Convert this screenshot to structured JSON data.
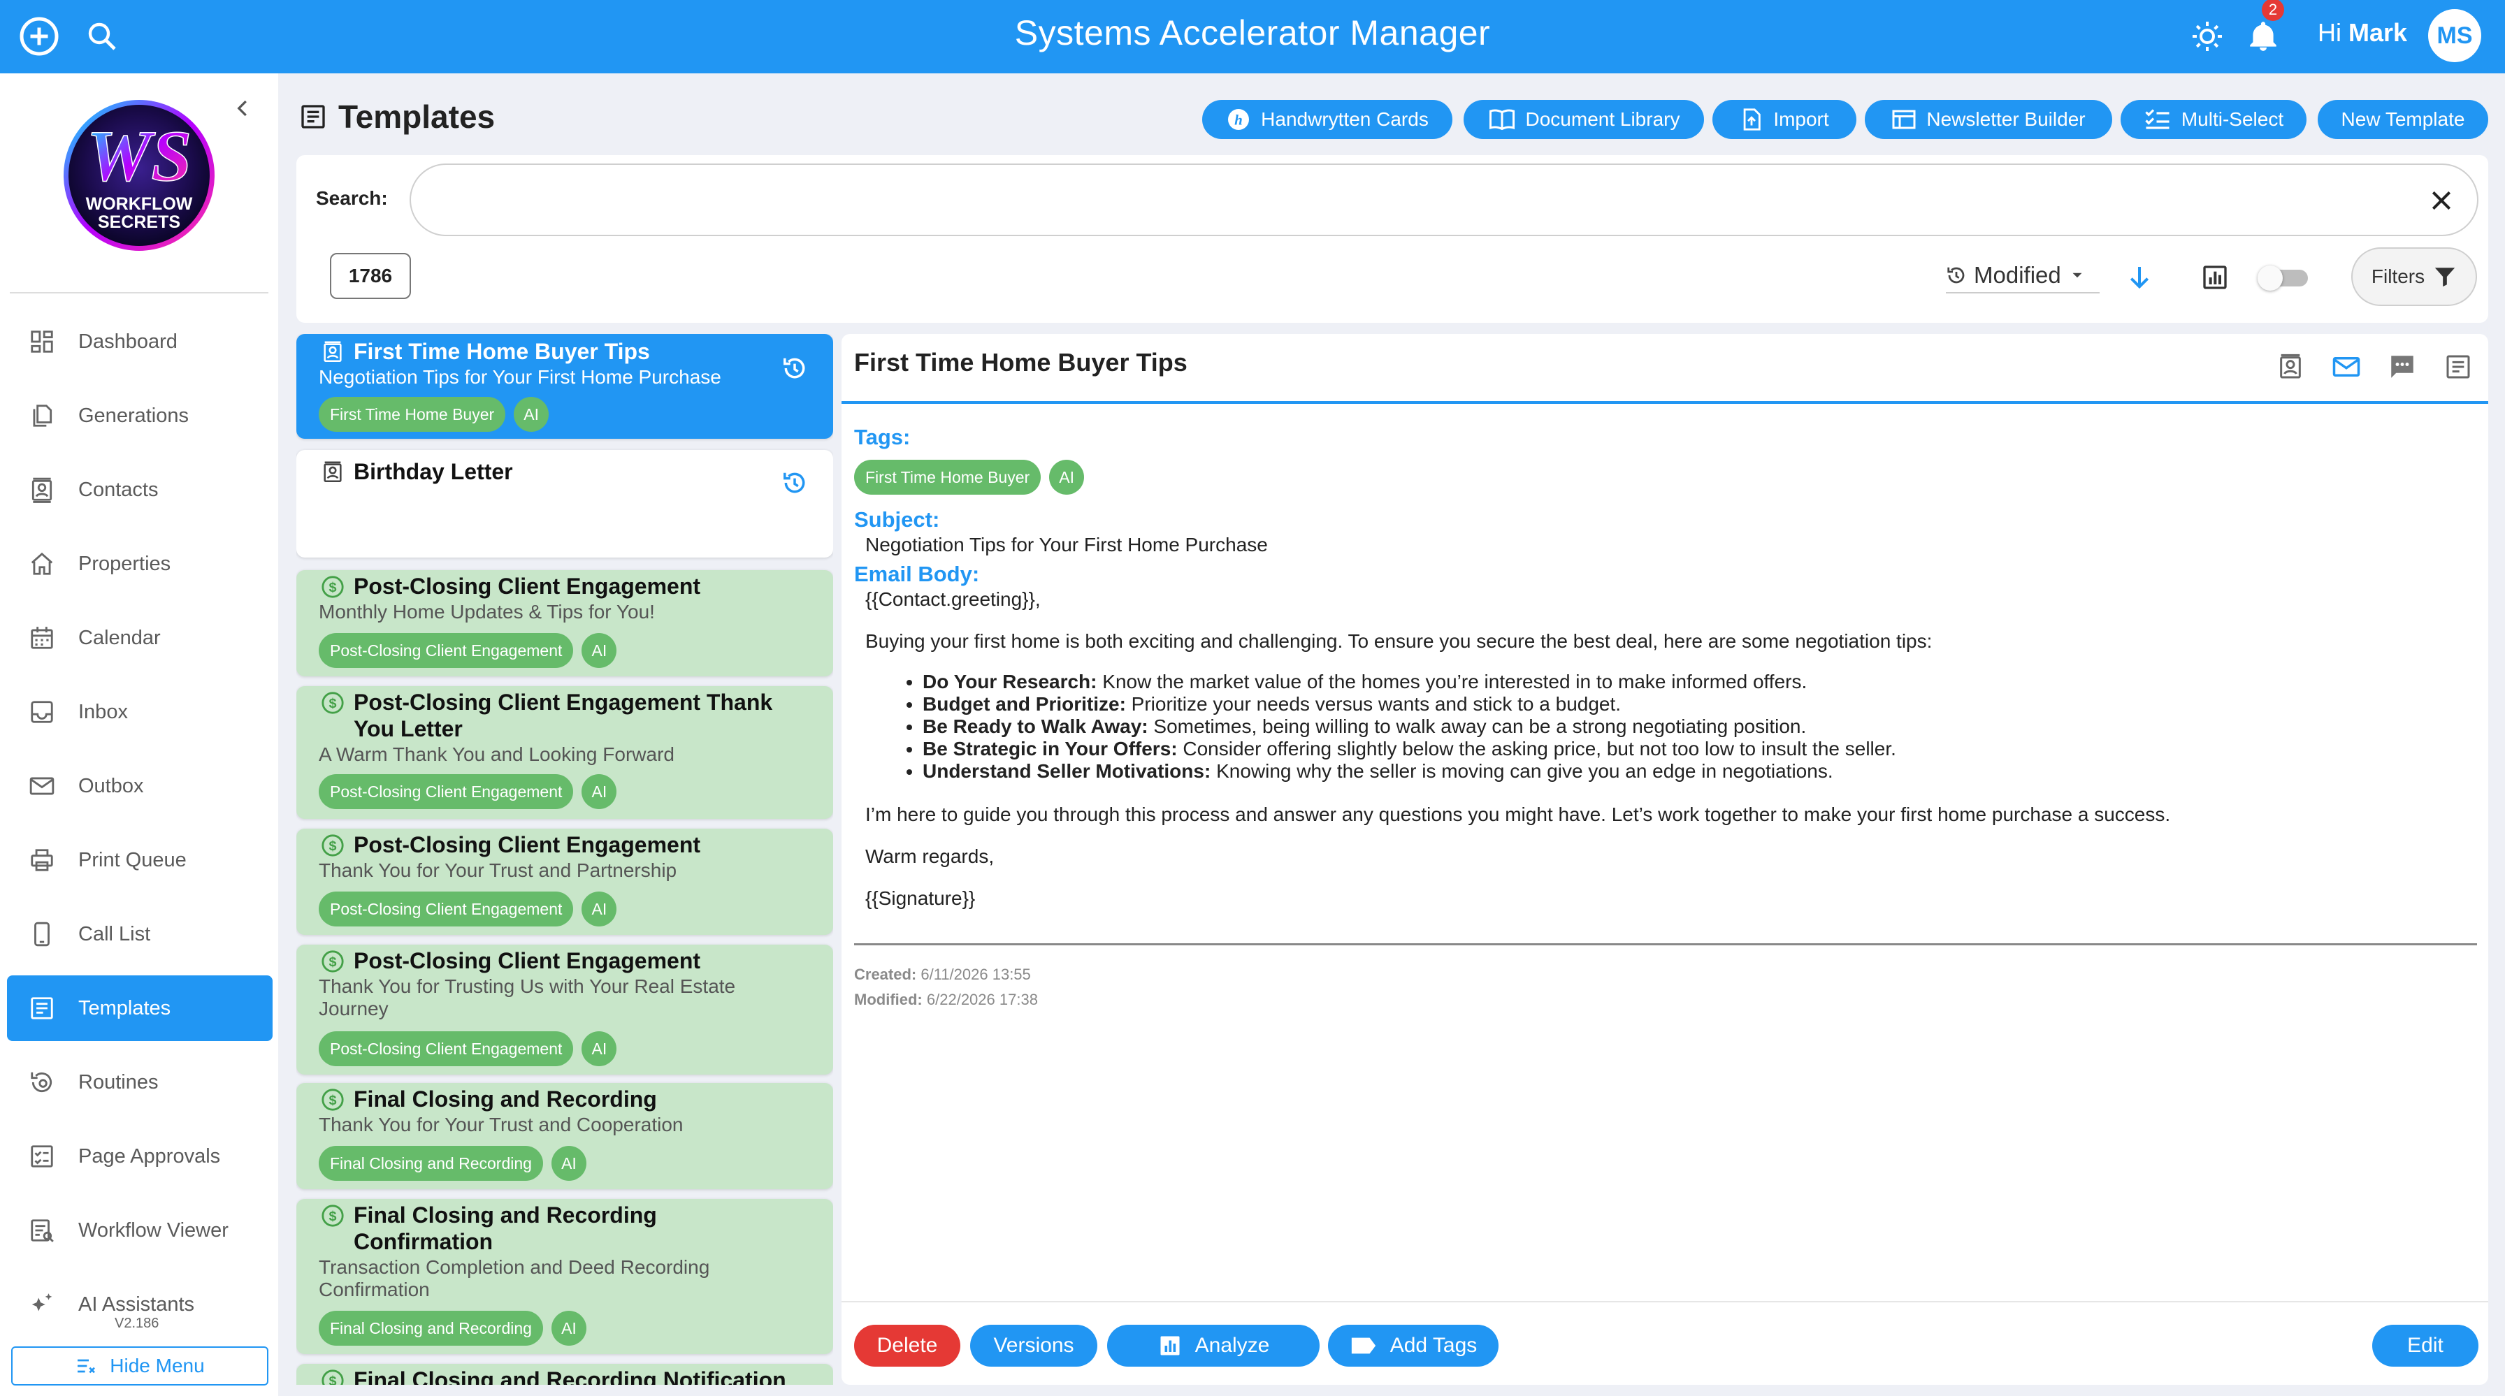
{
  "app": {
    "title": "Systems Accelerator Manager",
    "greeting": "Hi",
    "user_name": "Mark",
    "user_initials": "MS",
    "notification_count": "2",
    "accent_color": "#2196f3"
  },
  "sidebar": {
    "logo_alt": "WORKFLOW SECRETS",
    "items": [
      {
        "label": "Dashboard",
        "icon": "dashboard-icon"
      },
      {
        "label": "Generations",
        "icon": "generations-icon"
      },
      {
        "label": "Contacts",
        "icon": "contacts-icon"
      },
      {
        "label": "Properties",
        "icon": "home-icon"
      },
      {
        "label": "Calendar",
        "icon": "calendar-icon"
      },
      {
        "label": "Inbox",
        "icon": "inbox-icon"
      },
      {
        "label": "Outbox",
        "icon": "mail-icon"
      },
      {
        "label": "Print Queue",
        "icon": "printer-icon"
      },
      {
        "label": "Call List",
        "icon": "phone-icon"
      },
      {
        "label": "Templates",
        "icon": "templates-icon"
      },
      {
        "label": "Routines",
        "icon": "routines-icon"
      },
      {
        "label": "Page Approvals",
        "icon": "approvals-icon"
      },
      {
        "label": "Workflow Viewer",
        "icon": "workflow-icon"
      },
      {
        "label": "AI Assistants",
        "icon": "sparkle-icon"
      }
    ],
    "active_item": "Templates",
    "version": "V2.186",
    "hide_menu_label": "Hide Menu"
  },
  "page": {
    "title": "Templates",
    "header_buttons": [
      {
        "label": "Handwrytten Cards",
        "icon": "handwrytten-icon"
      },
      {
        "label": "Document Library",
        "icon": "book-icon"
      },
      {
        "label": "Import",
        "icon": "import-icon"
      },
      {
        "label": "Newsletter Builder",
        "icon": "newsletter-icon"
      },
      {
        "label": "Multi-Select",
        "icon": "checklist-icon"
      },
      {
        "label": "New Template",
        "icon": ""
      }
    ]
  },
  "search": {
    "label": "Search:",
    "value": "",
    "placeholder": "",
    "result_count": "1786",
    "sort_label": "Modified",
    "filters_label": "Filters"
  },
  "templates": [
    {
      "title": "First Time Home Buyer Tips",
      "subtitle": "Negotiation Tips for Your First Home Purchase",
      "tags": [
        "First Time Home Buyer",
        "AI"
      ],
      "icon": "contact-card-icon",
      "selected": true
    },
    {
      "title": "Birthday Letter",
      "subtitle": "",
      "tags": [],
      "icon": "contact-card-icon",
      "selected": false
    },
    {
      "title": "Post-Closing Client Engagement",
      "subtitle": "Monthly Home Updates & Tips for You!",
      "tags": [
        "Post-Closing Client Engagement",
        "AI"
      ],
      "icon": "dollar-icon",
      "selected": false
    },
    {
      "title": "Post-Closing Client Engagement Thank You Letter",
      "subtitle": "A Warm Thank You and Looking Forward",
      "tags": [
        "Post-Closing Client Engagement",
        "AI"
      ],
      "icon": "dollar-icon",
      "selected": false
    },
    {
      "title": "Post-Closing Client Engagement",
      "subtitle": "Thank You for Your Trust and Partnership",
      "tags": [
        "Post-Closing Client Engagement",
        "AI"
      ],
      "icon": "dollar-icon",
      "selected": false
    },
    {
      "title": "Post-Closing Client Engagement",
      "subtitle": "Thank You for Trusting Us with Your Real Estate Journey",
      "tags": [
        "Post-Closing Client Engagement",
        "AI"
      ],
      "icon": "dollar-icon",
      "selected": false
    },
    {
      "title": "Final Closing and Recording",
      "subtitle": "Thank You for Your Trust and Cooperation",
      "tags": [
        "Final Closing and Recording",
        "AI"
      ],
      "icon": "dollar-icon",
      "selected": false
    },
    {
      "title": "Final Closing and Recording Confirmation",
      "subtitle": "Transaction Completion and Deed Recording Confirmation",
      "tags": [
        "Final Closing and Recording",
        "AI"
      ],
      "icon": "dollar-icon",
      "selected": false
    },
    {
      "title": "Final Closing and Recording Notification",
      "subtitle": "",
      "tags": [],
      "icon": "dollar-icon",
      "selected": false
    }
  ],
  "detail": {
    "title": "First Time Home Buyer Tips",
    "tags_label": "Tags:",
    "tags": [
      "First Time Home Buyer",
      "AI"
    ],
    "subject_label": "Subject:",
    "subject": "Negotiation Tips for Your First Home Purchase",
    "body_label": "Email Body:",
    "greeting": "{{Contact.greeting}},",
    "intro": "Buying your first home is both exciting and challenging. To ensure you secure the best deal, here are some negotiation tips:",
    "tips": [
      {
        "bold": "Do Your Research:",
        "text": " Know the market value of the homes you’re interested in to make informed offers."
      },
      {
        "bold": "Budget and Prioritize:",
        "text": " Prioritize your needs versus wants and stick to a budget."
      },
      {
        "bold": "Be Ready to Walk Away:",
        "text": " Sometimes, being willing to walk away can be a strong negotiating position."
      },
      {
        "bold": "Be Strategic in Your Offers:",
        "text": " Consider offering slightly below the asking price, but not too low to insult the seller."
      },
      {
        "bold": "Understand Seller Motivations:",
        "text": " Knowing why the seller is moving can give you an edge in negotiations."
      }
    ],
    "closing": "I’m here to guide you through this process and answer any questions you might have. Let’s work together to make your first home purchase a success.",
    "signoff": "Warm regards,",
    "signature": "{{Signature}}",
    "created_label": "Created:",
    "created": "6/11/2026 13:55",
    "modified_label": "Modified:",
    "modified": "6/22/2026 17:38",
    "actions": {
      "delete": "Delete",
      "versions": "Versions",
      "analyze": "Analyze",
      "add_tags": "Add Tags",
      "edit": "Edit"
    }
  }
}
